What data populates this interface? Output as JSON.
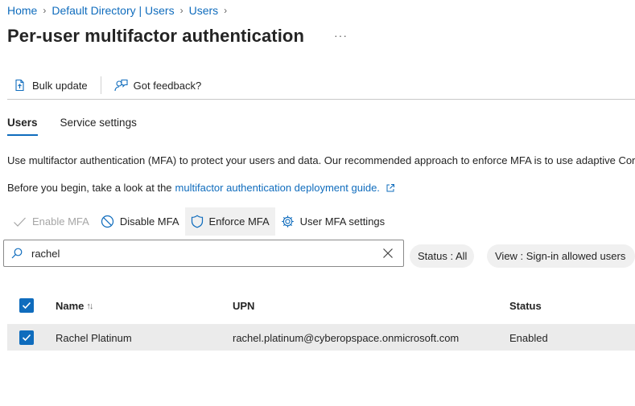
{
  "breadcrumb": [
    "Home",
    "Default Directory | Users",
    "Users"
  ],
  "page": {
    "title": "Per-user multifactor authentication",
    "more_label": "···"
  },
  "toolbar": {
    "bulk_update": "Bulk update",
    "feedback": "Got feedback?"
  },
  "tabs": [
    "Users",
    "Service settings"
  ],
  "description": {
    "line1": "Use multifactor authentication (MFA) to protect your users and data. Our recommended approach to enforce MFA is to use adaptive Cor",
    "line2_prefix": "Before you begin, take a look at the",
    "line2_link": "multifactor authentication deployment guide."
  },
  "actions": {
    "enable": "Enable MFA",
    "disable": "Disable MFA",
    "enforce": "Enforce MFA",
    "settings": "User MFA settings"
  },
  "search": {
    "value": "rachel",
    "placeholder": "Search"
  },
  "filters": {
    "status": "Status : All",
    "view": "View : Sign-in allowed users"
  },
  "table": {
    "columns": [
      "Name",
      "UPN",
      "Status"
    ],
    "sort_indicator": "↑↓",
    "rows": [
      {
        "name": "Rachel Platinum",
        "upn": "rachel.platinum@cyberopspace.onmicrosoft.com",
        "status": "Enabled"
      }
    ]
  },
  "colors": {
    "accent": "#0f6cbd",
    "selected_row": "#ebebeb",
    "disabled_text": "#a6a6a6"
  }
}
